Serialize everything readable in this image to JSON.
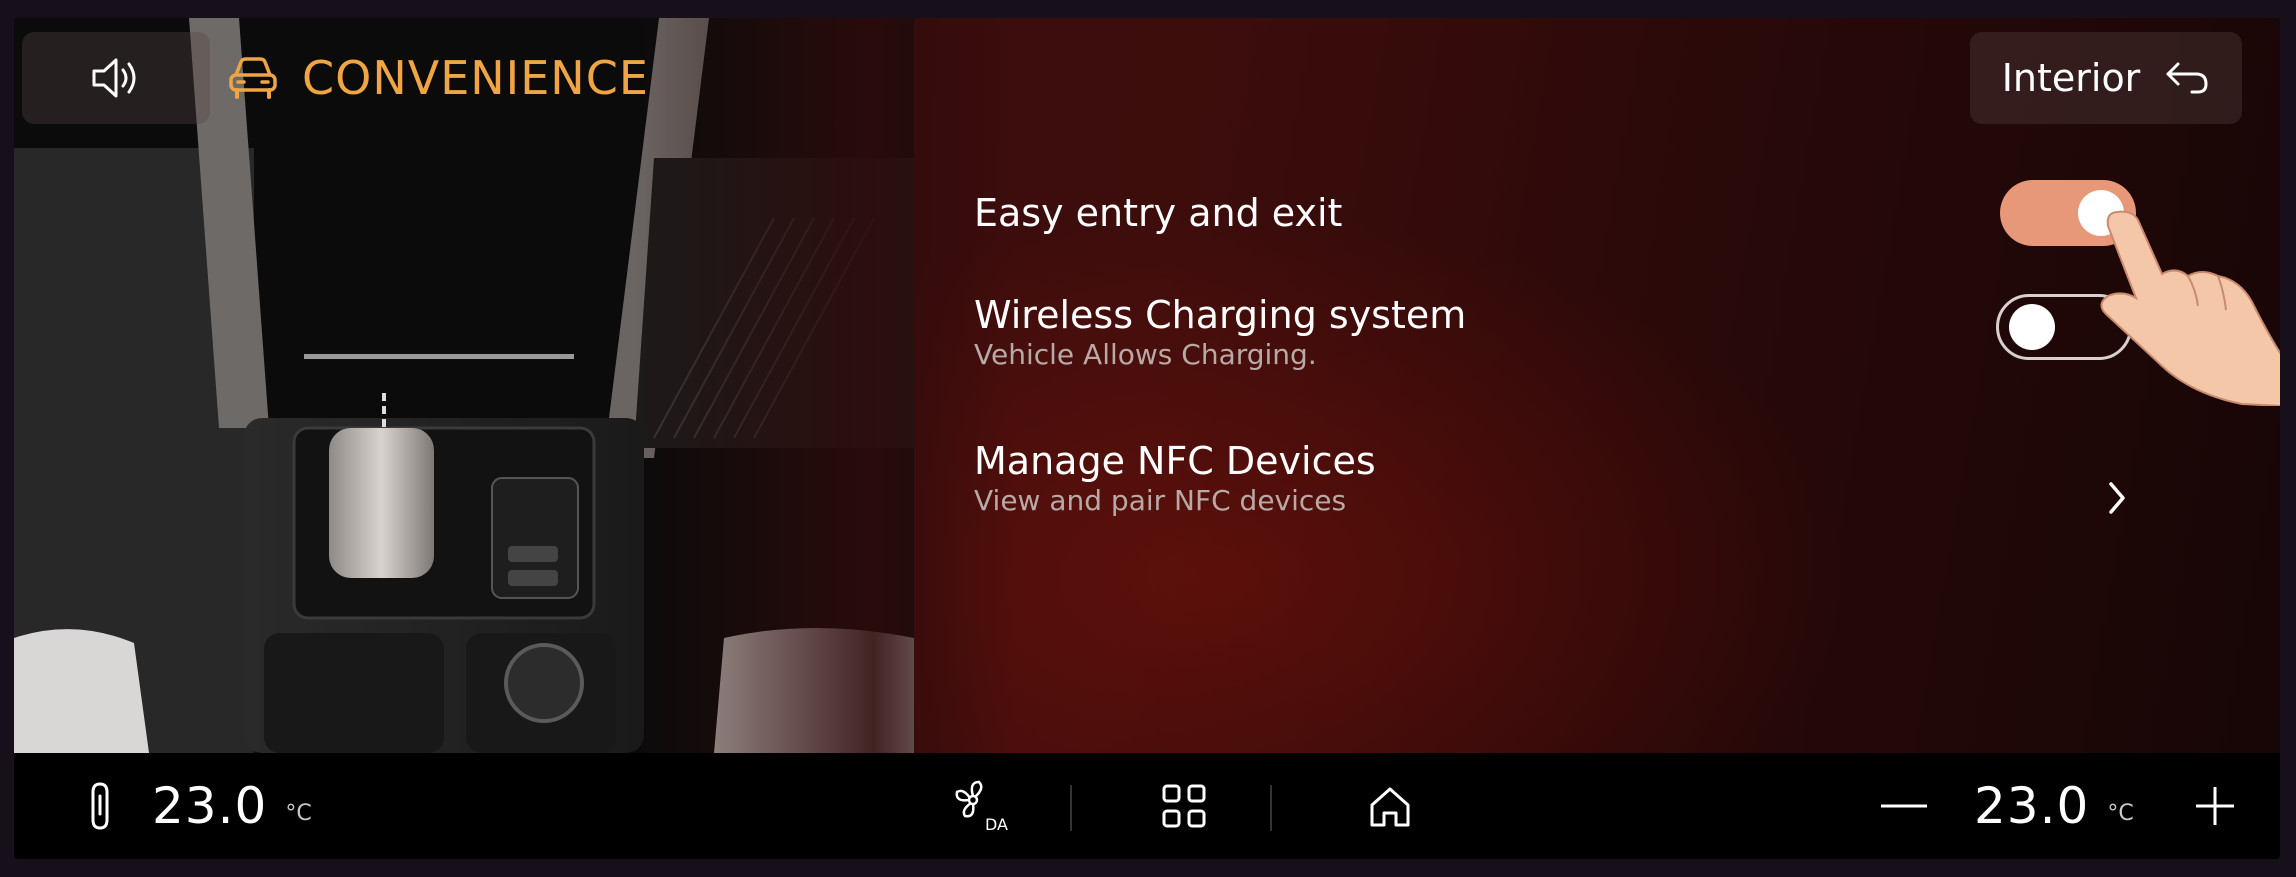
{
  "header": {
    "title": "CONVENIENCE",
    "title_icon": "car-icon",
    "sound_icon": "speaker-icon",
    "back_button_label": "Interior",
    "back_icon": "back-arrow-icon"
  },
  "settings": [
    {
      "title": "Easy entry and exit",
      "subtitle": "",
      "control": "toggle",
      "state": "on"
    },
    {
      "title": "Wireless Charging system",
      "subtitle": "Vehicle Allows Charging.",
      "control": "toggle",
      "state": "off"
    },
    {
      "title": "Manage NFC Devices",
      "subtitle": "View and pair NFC devices",
      "control": "chevron"
    }
  ],
  "bottom_bar": {
    "left_temp": "23.0",
    "left_unit": "°C",
    "right_temp": "23.0",
    "right_unit": "°C",
    "icons": [
      "seat-heat-icon",
      "fan-auto-icon",
      "apps-grid-icon",
      "home-icon",
      "minus-icon",
      "plus-icon"
    ]
  },
  "colors": {
    "accent": "#f0a544",
    "toggle_on": "#e69878",
    "background": "#3a0d0c"
  }
}
